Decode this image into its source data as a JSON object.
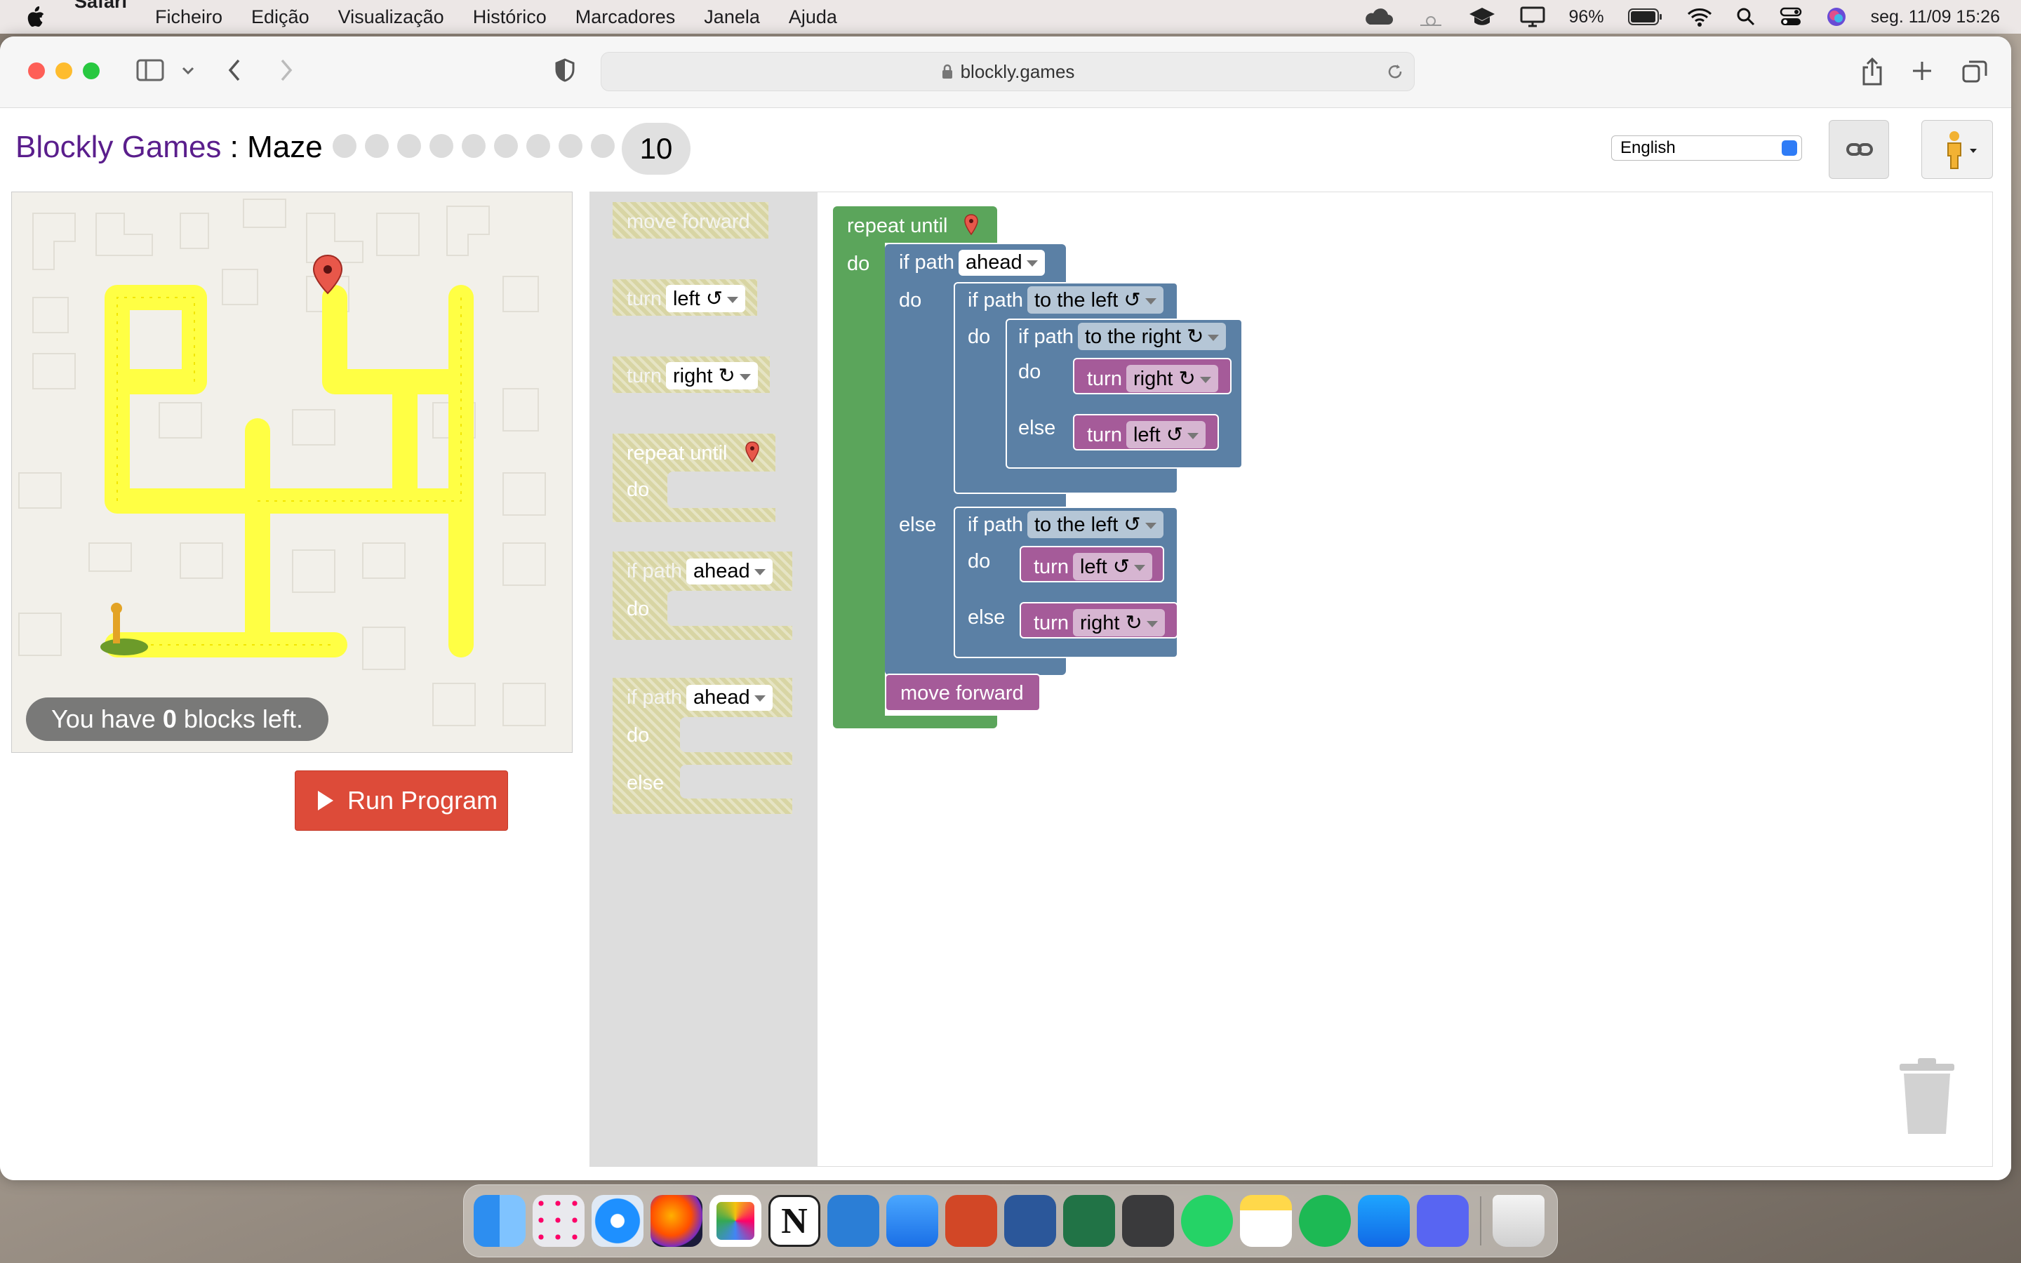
{
  "menubar": {
    "app": "Safari",
    "items": [
      "Ficheiro",
      "Edição",
      "Visualização",
      "Histórico",
      "Marcadores",
      "Janela",
      "Ajuda"
    ],
    "battery": "96%",
    "datetime": "seg. 11/09  15:26"
  },
  "browser": {
    "url": "blockly.games"
  },
  "page": {
    "brand": "Blockly Games",
    "sep": " : ",
    "game": "Maze",
    "level": "10",
    "language": "English"
  },
  "maze": {
    "blocks_left_prefix": "You have ",
    "blocks_left_count": "0",
    "blocks_left_suffix": " blocks left."
  },
  "run_label": "Run Program",
  "flyout": {
    "move_forward": "move forward",
    "turn": "turn",
    "left": "left ↺",
    "right": "right ↻",
    "repeat_until": "repeat until",
    "do": "do",
    "else": "else",
    "if_path": "if path",
    "ahead": "ahead"
  },
  "program": {
    "repeat_until": "repeat until",
    "do": "do",
    "else": "else",
    "if_path": "if path",
    "turn": "turn",
    "ahead": "ahead",
    "to_the_left": "to the left ↺",
    "to_the_right": "to the right ↻",
    "right": "right ↻",
    "left": "left ↺",
    "move_forward": "move forward"
  },
  "colors": {
    "loop": "#5ba55b",
    "logic": "#5b80a5",
    "action": "#a55b99",
    "run": "#dd4b39",
    "path": "#ffff44"
  }
}
